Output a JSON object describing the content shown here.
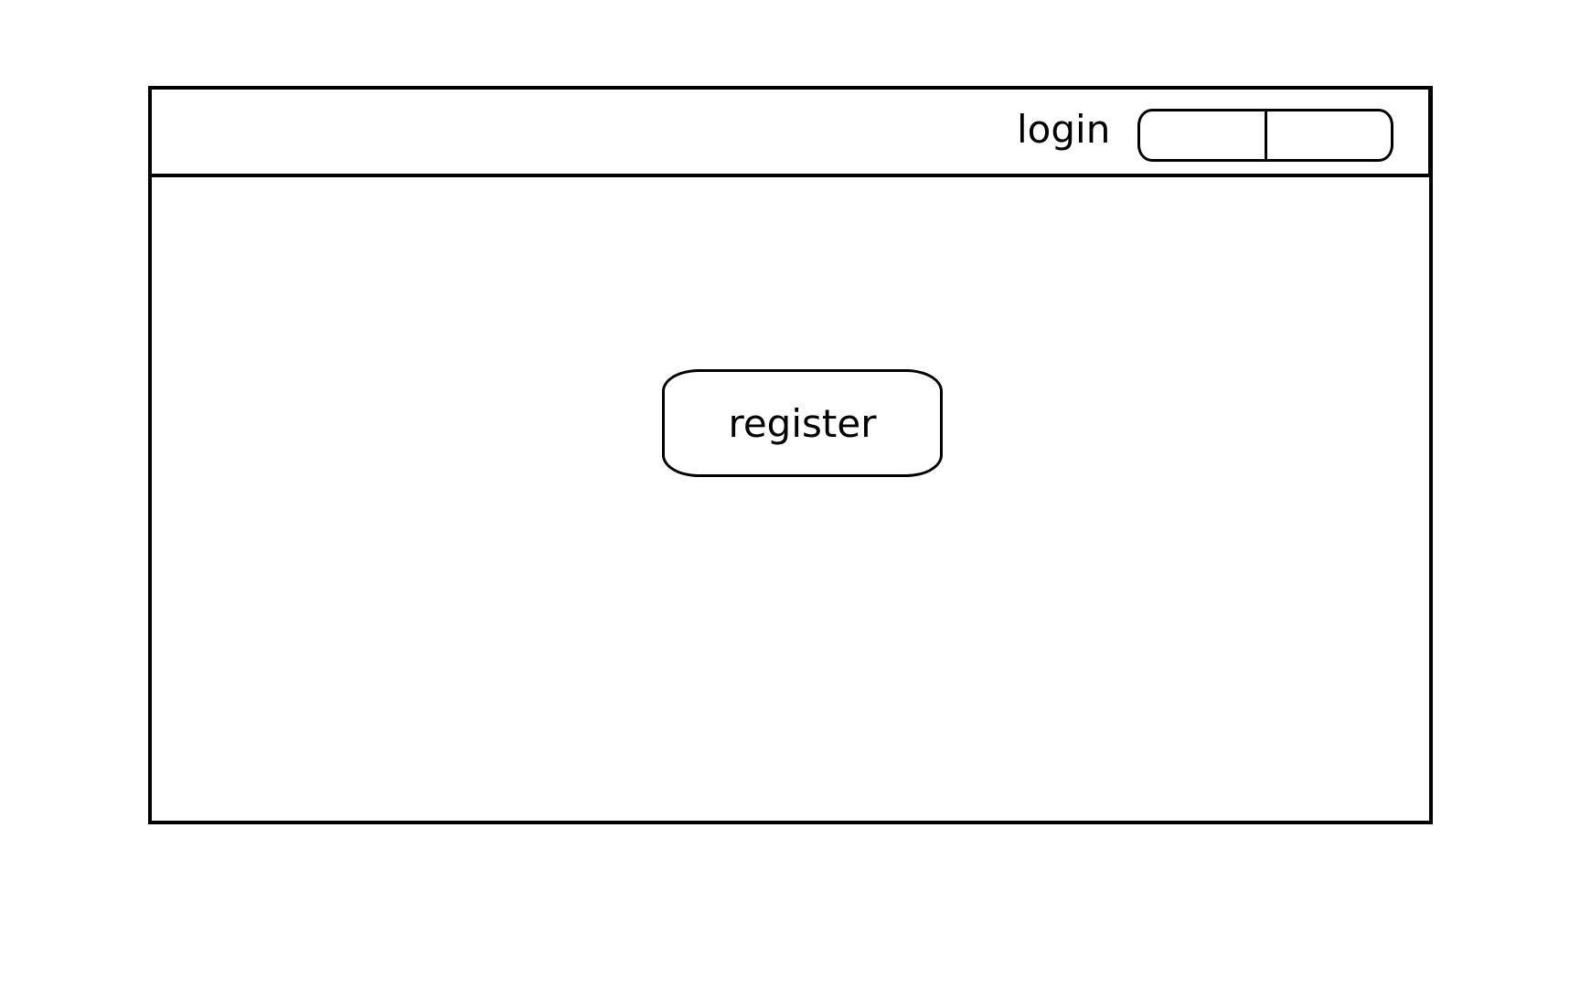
{
  "header": {
    "login_label": "login",
    "login_field": {
      "segments": [
        {
          "value": ""
        },
        {
          "value": ""
        }
      ]
    }
  },
  "main": {
    "register_label": "register"
  },
  "colors": {
    "stroke": "#000000",
    "background": "#ffffff"
  }
}
